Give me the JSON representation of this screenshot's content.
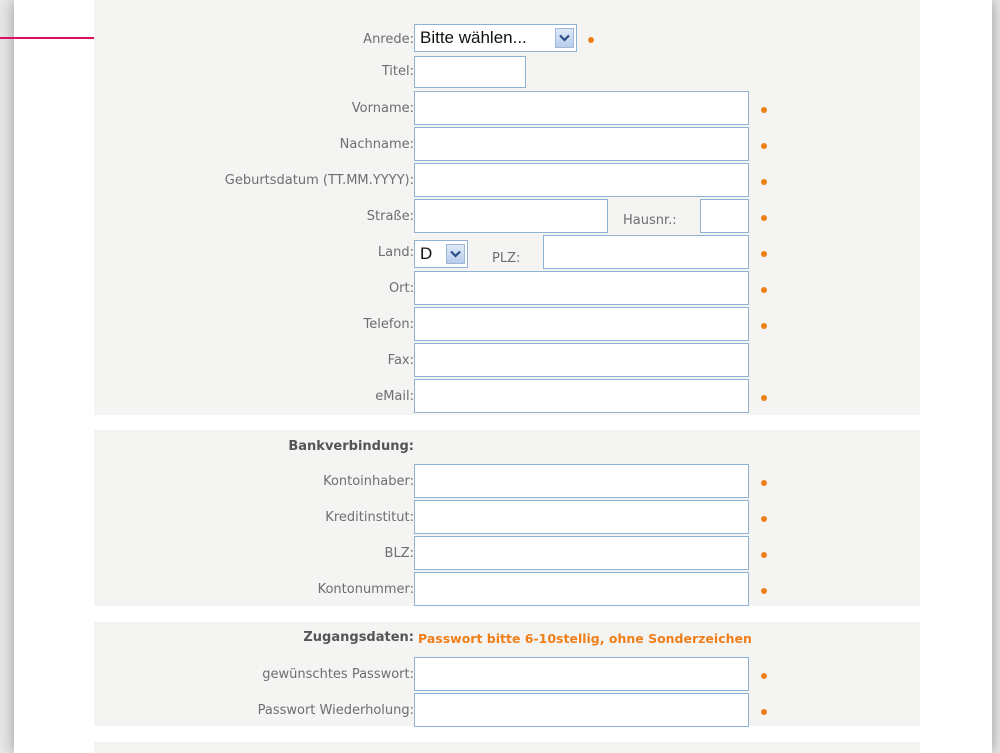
{
  "form": {
    "anrede": {
      "label": "Anrede:",
      "value": "Bitte wählen..."
    },
    "titel": {
      "label": "Titel:"
    },
    "vorname": {
      "label": "Vorname:"
    },
    "nachname": {
      "label": "Nachname:"
    },
    "geburtsdatum": {
      "label": "Geburtsdatum (TT.MM.YYYY):"
    },
    "strasse": {
      "label": "Straße:"
    },
    "hausnr": {
      "label": "Hausnr.:"
    },
    "land": {
      "label": "Land:",
      "value": "D"
    },
    "plz": {
      "label": "PLZ:"
    },
    "ort": {
      "label": "Ort:"
    },
    "telefon": {
      "label": "Telefon:"
    },
    "fax": {
      "label": "Fax:"
    },
    "email": {
      "label": "eMail:"
    }
  },
  "bank": {
    "heading": "Bankverbindung:",
    "kontoinhaber": {
      "label": "Kontoinhaber:"
    },
    "kreditinstitut": {
      "label": "Kreditinstitut:"
    },
    "blz": {
      "label": "BLZ:"
    },
    "kontonummer": {
      "label": "Kontonummer:"
    }
  },
  "access": {
    "heading": "Zugangsdaten:",
    "note": "Passwort bitte 6-10stellig, ohne Sonderzeichen",
    "passwort": {
      "label": "gewünschtes Passwort:"
    },
    "wiederholung": {
      "label": "Passwort Wiederholung:"
    }
  },
  "colors": {
    "required_dot": "#f07f1a",
    "input_border": "#8db2d6",
    "arrow": "#d6115e",
    "block_bg": "#f4f4f2"
  },
  "icons": {
    "dropdown": "chevron-down-icon",
    "required": "required-dot-icon",
    "pointer": "arrow-right-icon"
  }
}
